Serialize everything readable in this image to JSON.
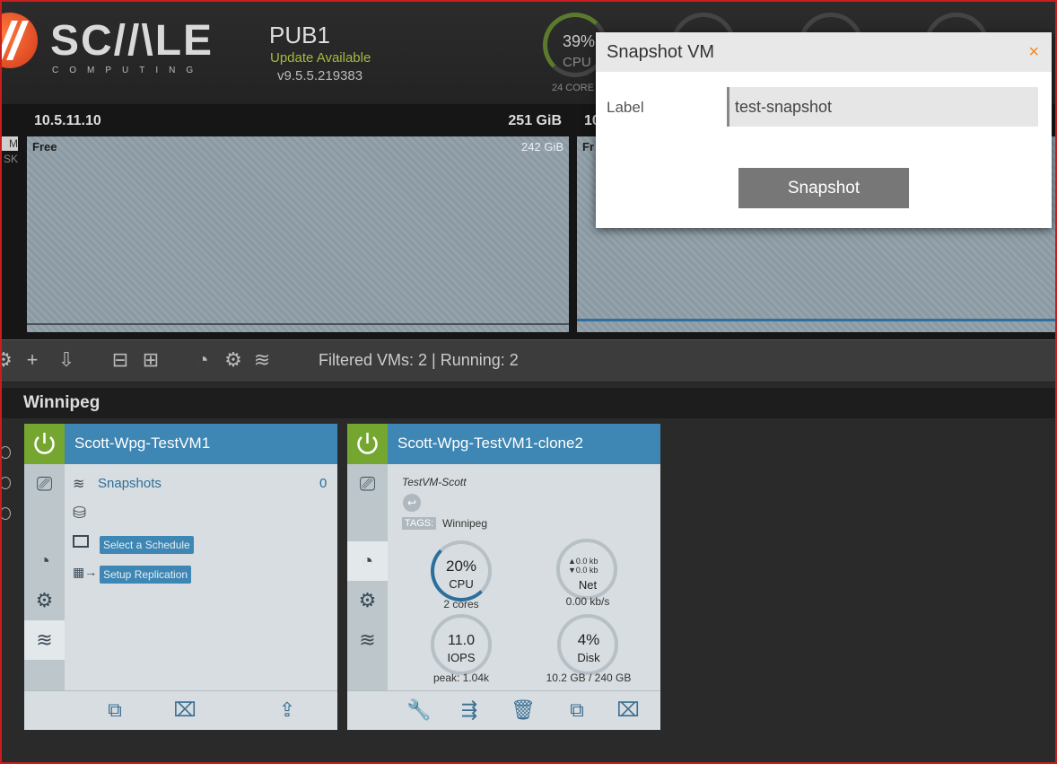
{
  "header": {
    "logo_text": "SC//\\LE",
    "logo_sub": "COMPUTING",
    "cluster_name": "PUB1",
    "update_text": "Update Available",
    "version": "v9.5.5.219383",
    "cpu_percent": "39%",
    "cpu_label": "CPU",
    "cpu_cores": "24 CORE"
  },
  "node_tabs": {
    "m": "M",
    "k": "SK"
  },
  "nodes": [
    {
      "ip": "10.5.11.10",
      "capacity": "251 GiB",
      "free_label": "Free",
      "free_value": "242 GiB"
    },
    {
      "ip": "10",
      "capacity": "",
      "free_label": "Fr",
      "free_value": ""
    }
  ],
  "toolbar": {
    "filtered": "Filtered VMs: 2 | Running: 2"
  },
  "group": {
    "title": "Winnipeg"
  },
  "vm1": {
    "name": "Scott-Wpg-TestVM1",
    "snapshots_label": "Snapshots",
    "snapshots_count": "0",
    "schedule_label": "Select a Schedule",
    "replication_label": "Setup Replication"
  },
  "vm2": {
    "name": "Scott-Wpg-TestVM1-clone2",
    "description": "TestVM-Scott",
    "tags_label": "TAGS:",
    "tag": "Winnipeg",
    "cpu_value": "20%",
    "cpu_label": "CPU",
    "cpu_sub": "2 cores",
    "net_up": "▲0.0 kb",
    "net_down": "▼0.0 kb",
    "net_label": "Net",
    "net_sub": "0.00 kb/s",
    "iops_value": "11.0",
    "iops_label": "IOPS",
    "iops_sub": "peak: 1.04k",
    "disk_value": "4%",
    "disk_label": "Disk",
    "disk_sub": "10.2 GB / 240 GB"
  },
  "modal": {
    "title": "Snapshot VM",
    "close": "×",
    "label": "Label",
    "input_value": "test-snapshot",
    "button": "Snapshot"
  },
  "colors": {
    "accent_blue": "#3e86b3",
    "power_green": "#74a630",
    "close_orange": "#f08a24"
  }
}
